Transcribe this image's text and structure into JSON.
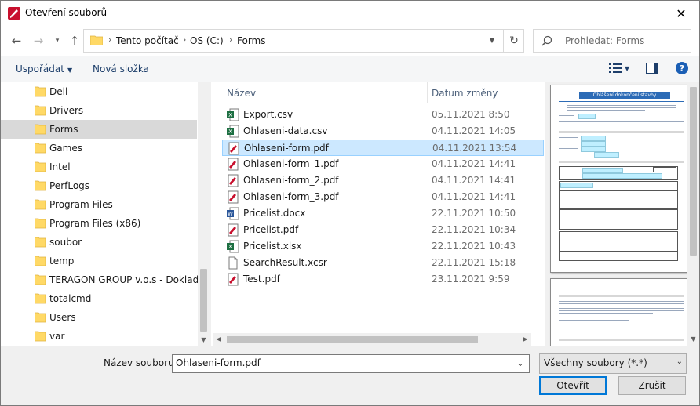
{
  "window": {
    "title": "Otevření souborů"
  },
  "address": {
    "crumbs": [
      "Tento počítač",
      "OS (C:)",
      "Forms"
    ]
  },
  "search": {
    "placeholder": "Prohledat: Forms"
  },
  "toolbar": {
    "organize": "Uspořádat",
    "new_folder": "Nová složka"
  },
  "tree": {
    "items": [
      {
        "label": "Dell"
      },
      {
        "label": "Drivers"
      },
      {
        "label": "Forms",
        "selected": true
      },
      {
        "label": "Games"
      },
      {
        "label": "Intel"
      },
      {
        "label": "PerfLogs"
      },
      {
        "label": "Program Files"
      },
      {
        "label": "Program Files (x86)"
      },
      {
        "label": "soubor"
      },
      {
        "label": "temp"
      },
      {
        "label": "TERAGON GROUP v.o.s - Doklady"
      },
      {
        "label": "totalcmd"
      },
      {
        "label": "Users"
      },
      {
        "label": "var"
      }
    ]
  },
  "files": {
    "columns": {
      "name": "Název",
      "date": "Datum změny"
    },
    "rows": [
      {
        "name": "Export.csv",
        "date": "05.11.2021 8:50",
        "icon": "excel-icon"
      },
      {
        "name": "Ohlaseni-data.csv",
        "date": "04.11.2021 14:05",
        "icon": "excel-icon"
      },
      {
        "name": "Ohlaseni-form.pdf",
        "date": "04.11.2021 13:54",
        "icon": "pdf-icon",
        "selected": true
      },
      {
        "name": "Ohlaseni-form_1.pdf",
        "date": "04.11.2021 14:41",
        "icon": "pdf-icon"
      },
      {
        "name": "Ohlaseni-form_2.pdf",
        "date": "04.11.2021 14:41",
        "icon": "pdf-icon"
      },
      {
        "name": "Ohlaseni-form_3.pdf",
        "date": "04.11.2021 14:41",
        "icon": "pdf-icon"
      },
      {
        "name": "Pricelist.docx",
        "date": "22.11.2021 10:50",
        "icon": "word-icon"
      },
      {
        "name": "Pricelist.pdf",
        "date": "22.11.2021 10:34",
        "icon": "pdf-icon"
      },
      {
        "name": "Pricelist.xlsx",
        "date": "22.11.2021 10:43",
        "icon": "excel-icon"
      },
      {
        "name": "SearchResult.xcsr",
        "date": "22.11.2021 15:18",
        "icon": "document-icon"
      },
      {
        "name": "Test.pdf",
        "date": "23.11.2021 9:59",
        "icon": "pdf-icon"
      }
    ]
  },
  "preview": {
    "doc_title": "Ohlášení dokončení stavby"
  },
  "bottom": {
    "filename_label": "Název souboru:",
    "filename_value": "Ohlaseni-form.pdf",
    "filetype_value": "Všechny soubory (*.*)",
    "open_label": "Otevřít",
    "cancel_label": "Zrušit"
  },
  "colors": {
    "selection": "#cce8ff",
    "accent": "#0078d7",
    "folder": "#ffd966"
  }
}
